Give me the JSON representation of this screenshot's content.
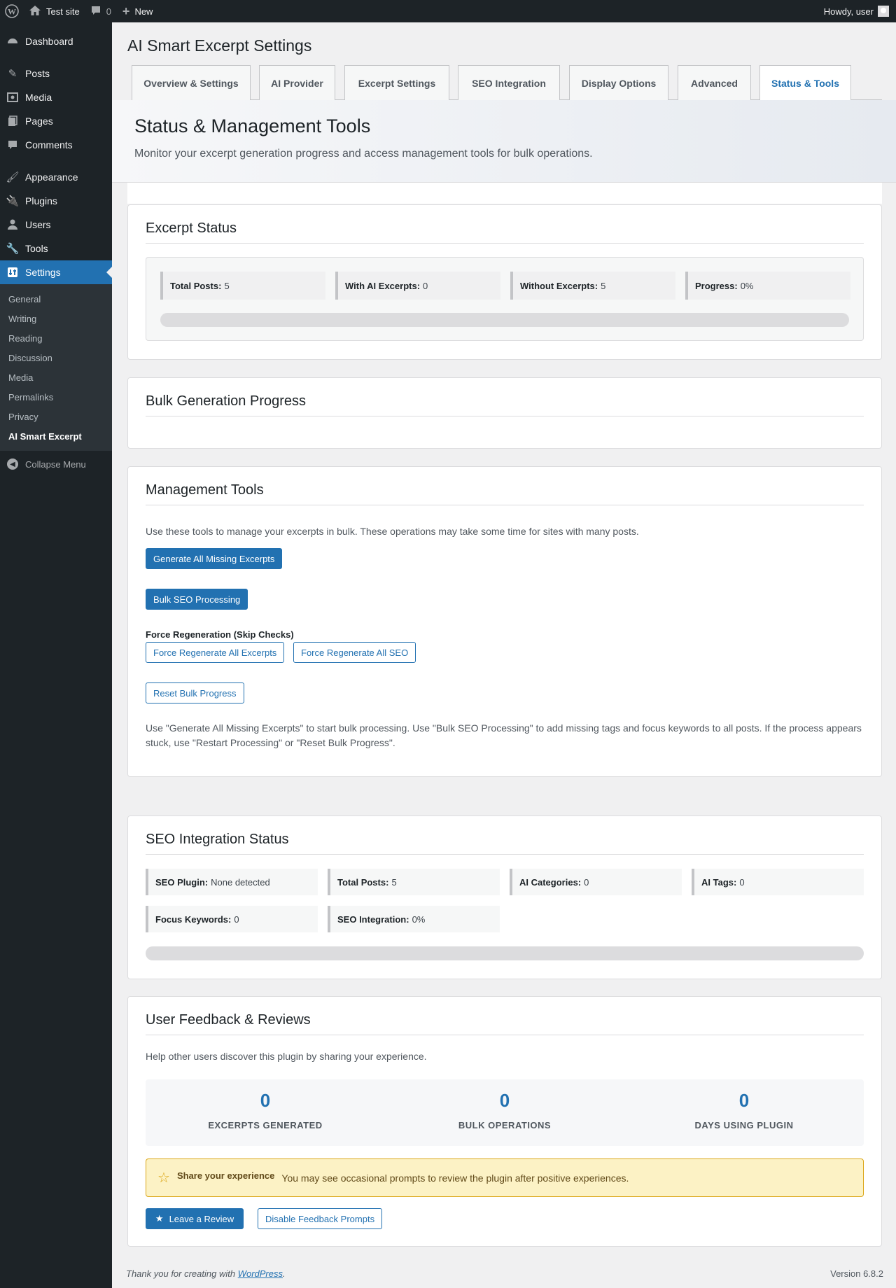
{
  "admin_bar": {
    "site_name": "Test site",
    "comments_count": "0",
    "new_label": "New",
    "greeting": "Howdy, user"
  },
  "sidebar": {
    "items": [
      {
        "label": "Dashboard",
        "icon": "dashboard-icon"
      },
      {
        "label": "Posts",
        "icon": "pin-icon"
      },
      {
        "label": "Media",
        "icon": "media-icon"
      },
      {
        "label": "Pages",
        "icon": "pages-icon"
      },
      {
        "label": "Comments",
        "icon": "comment-icon"
      },
      {
        "label": "Appearance",
        "icon": "brush-icon"
      },
      {
        "label": "Plugins",
        "icon": "plugin-icon"
      },
      {
        "label": "Users",
        "icon": "user-icon"
      },
      {
        "label": "Tools",
        "icon": "wrench-icon"
      },
      {
        "label": "Settings",
        "icon": "settings-icon"
      }
    ],
    "submenu": [
      "General",
      "Writing",
      "Reading",
      "Discussion",
      "Media",
      "Permalinks",
      "Privacy",
      "AI Smart Excerpt"
    ],
    "collapse_label": "Collapse Menu"
  },
  "page": {
    "title": "AI Smart Excerpt Settings",
    "tabs": [
      "Overview & Settings",
      "AI Provider",
      "Excerpt Settings",
      "SEO Integration",
      "Display Options",
      "Advanced",
      "Status & Tools"
    ],
    "active_tab": "Status & Tools"
  },
  "banner": {
    "title": "Status & Management Tools",
    "subtitle": "Monitor your excerpt generation progress and access management tools for bulk operations."
  },
  "excerpt_status": {
    "title": "Excerpt Status",
    "stats": [
      {
        "label": "Total Posts:",
        "value": "5"
      },
      {
        "label": "With AI Excerpts:",
        "value": "0"
      },
      {
        "label": "Without Excerpts:",
        "value": "5"
      },
      {
        "label": "Progress:",
        "value": "0%"
      }
    ],
    "progress_fraction": 0
  },
  "bulk_progress": {
    "title": "Bulk Generation Progress"
  },
  "management_tools": {
    "title": "Management Tools",
    "intro": "Use these tools to manage your excerpts in bulk. These operations may take some time for sites with many posts.",
    "generate_button": "Generate All Missing Excerpts",
    "bulk_seo_button": "Bulk SEO Processing",
    "force_label": "Force Regeneration (Skip Checks)",
    "force_excerpts_button": "Force Regenerate All Excerpts",
    "force_seo_button": "Force Regenerate All SEO",
    "reset_button": "Reset Bulk Progress",
    "help_text": "Use \"Generate All Missing Excerpts\" to start bulk processing. Use \"Bulk SEO Processing\" to add missing tags and focus keywords to all posts. If the process appears stuck, use \"Restart Processing\" or \"Reset Bulk Progress\"."
  },
  "seo_status": {
    "title": "SEO Integration Status",
    "stats": [
      {
        "label": "SEO Plugin:",
        "value": "None detected"
      },
      {
        "label": "Total Posts:",
        "value": "5"
      },
      {
        "label": "AI Categories:",
        "value": "0"
      },
      {
        "label": "AI Tags:",
        "value": "0"
      },
      {
        "label": "Focus Keywords:",
        "value": "0"
      },
      {
        "label": "SEO Integration:",
        "value": "0%"
      }
    ],
    "progress_fraction": 0
  },
  "feedback": {
    "title": "User Feedback & Reviews",
    "intro": "Help other users discover this plugin by sharing your experience.",
    "stats": [
      {
        "value": "0",
        "label": "EXCERPTS GENERATED"
      },
      {
        "value": "0",
        "label": "BULK OPERATIONS"
      },
      {
        "value": "0",
        "label": "DAYS USING PLUGIN"
      }
    ],
    "notice_title": "Share your experience",
    "notice_text": "You may see occasional prompts to review the plugin after positive experiences.",
    "review_button": "Leave a Review",
    "disable_button": "Disable Feedback Prompts"
  },
  "footer": {
    "thanks_prefix": "Thank you for creating with",
    "wordpress_link": "WordPress",
    "thanks_suffix": ".",
    "version": "Version 6.8.2"
  }
}
